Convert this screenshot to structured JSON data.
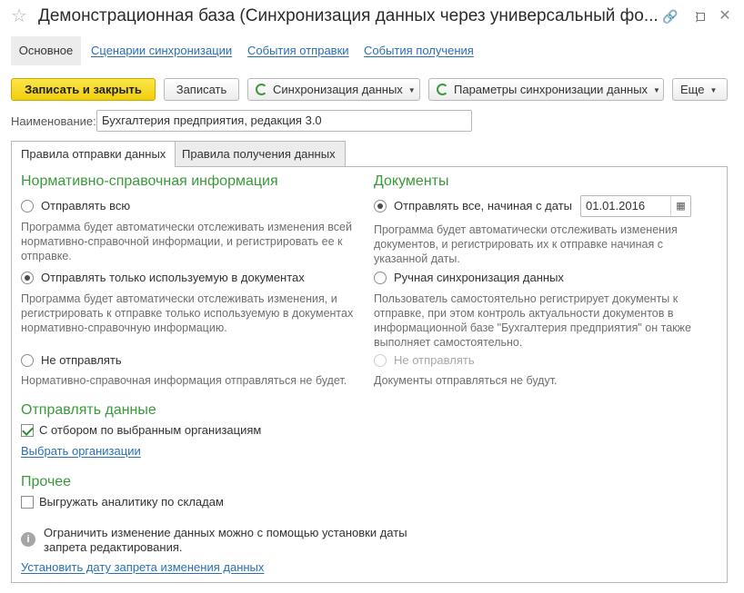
{
  "window": {
    "title": "Демонстрационная база  (Синхронизация данных через универсальный фо...",
    "icons": [
      "star-icon",
      "link-icon",
      "more-icon",
      "maximize-icon",
      "close-icon"
    ]
  },
  "nav": {
    "items": [
      {
        "label": "Основное"
      },
      {
        "label": "Сценарии синхронизации"
      },
      {
        "label": "События отправки"
      },
      {
        "label": "События получения"
      }
    ]
  },
  "toolbar": {
    "save_close": "Записать и закрыть",
    "save": "Записать",
    "sync": "Синхронизация данных",
    "sync_params": "Параметры синхронизации данных",
    "more": "Еще"
  },
  "name_field": {
    "label": "Наименование:",
    "value": "Бухгалтерия предприятия, редакция 3.0"
  },
  "tabs": [
    {
      "label": "Правила отправки данных",
      "active": true
    },
    {
      "label": "Правила получения данных",
      "active": false
    }
  ],
  "reference": {
    "heading": "Нормативно-справочная информация",
    "opt_all": "Отправлять всю",
    "opt_all_hint_1": "Программа будет автоматически отслеживать изменения всей",
    "opt_all_hint_2": "нормативно-справочной информации, и регистрировать ее к",
    "opt_all_hint_3": "отправке.",
    "opt_used": "Отправлять только используемую в документах",
    "opt_used_hint_1": "Программа будет автоматически отслеживать изменения, и",
    "opt_used_hint_2": "регистрировать к отправке только используемую в документах",
    "opt_used_hint_3": "нормативно-справочную информацию.",
    "opt_none": "Не отправлять",
    "opt_none_hint": "Нормативно-справочная информация отправляться не будет.",
    "selected": "opt_used"
  },
  "documents": {
    "heading": "Документы",
    "opt_from_date": "Отправлять все, начиная с даты",
    "date_value": "01.01.2016",
    "opt_from_date_hint_1": "Программа будет автоматически отслеживать изменения",
    "opt_from_date_hint_2": "документов, и регистрировать их к отправке начиная с",
    "opt_from_date_hint_3": "указанной даты.",
    "opt_manual": "Ручная синхронизация данных",
    "opt_manual_hint_1": "Пользователь самостоятельно регистрирует документы к",
    "opt_manual_hint_2": "отправке, при этом контроль актуальности документов в",
    "opt_manual_hint_3": "информационной базе \"Бухгалтерия предприятия\" он также",
    "opt_manual_hint_4": "выполняет самостоятельно.",
    "opt_none": "Не отправлять",
    "opt_none_hint": "Документы отправляться не будут.",
    "selected": "opt_from_date"
  },
  "send_data": {
    "heading": "Отправлять данные",
    "filter_checkbox": "С отбором по выбранным организациям",
    "filter_checked": true,
    "choose_orgs_link": "Выбрать организации"
  },
  "other": {
    "heading": "Прочее",
    "warehouse_checkbox": "Выгружать аналитику по складам",
    "warehouse_checked": false,
    "info_line_1": "Ограничить изменение данных можно с помощью установки даты",
    "info_line_2": "запрета редактирования.",
    "set_date_link": "Установить дату запрета изменения данных"
  },
  "colors": {
    "accent_green": "#3a9a3a",
    "link_blue": "#2a6fb5",
    "primary_button": "#f1cf0b"
  }
}
